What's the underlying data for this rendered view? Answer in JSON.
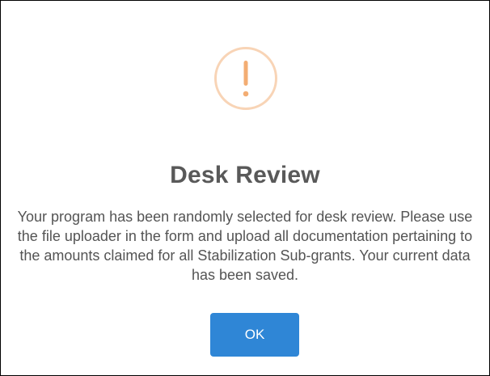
{
  "dialog": {
    "icon": "warning-exclamation-icon",
    "title": "Desk Review",
    "message": "Your program has been randomly selected for desk review. Please use the file uploader in the form and upload all documentation pertaining to the amounts claimed for all Stabilization Sub-grants. Your current data has been saved.",
    "ok_label": "OK"
  },
  "colors": {
    "icon_stroke": "#f8d4b6",
    "icon_mark": "#f3ad73",
    "button_bg": "#2f86d6",
    "button_text": "#ffffff",
    "title_text": "#595959",
    "body_text": "#545454"
  }
}
